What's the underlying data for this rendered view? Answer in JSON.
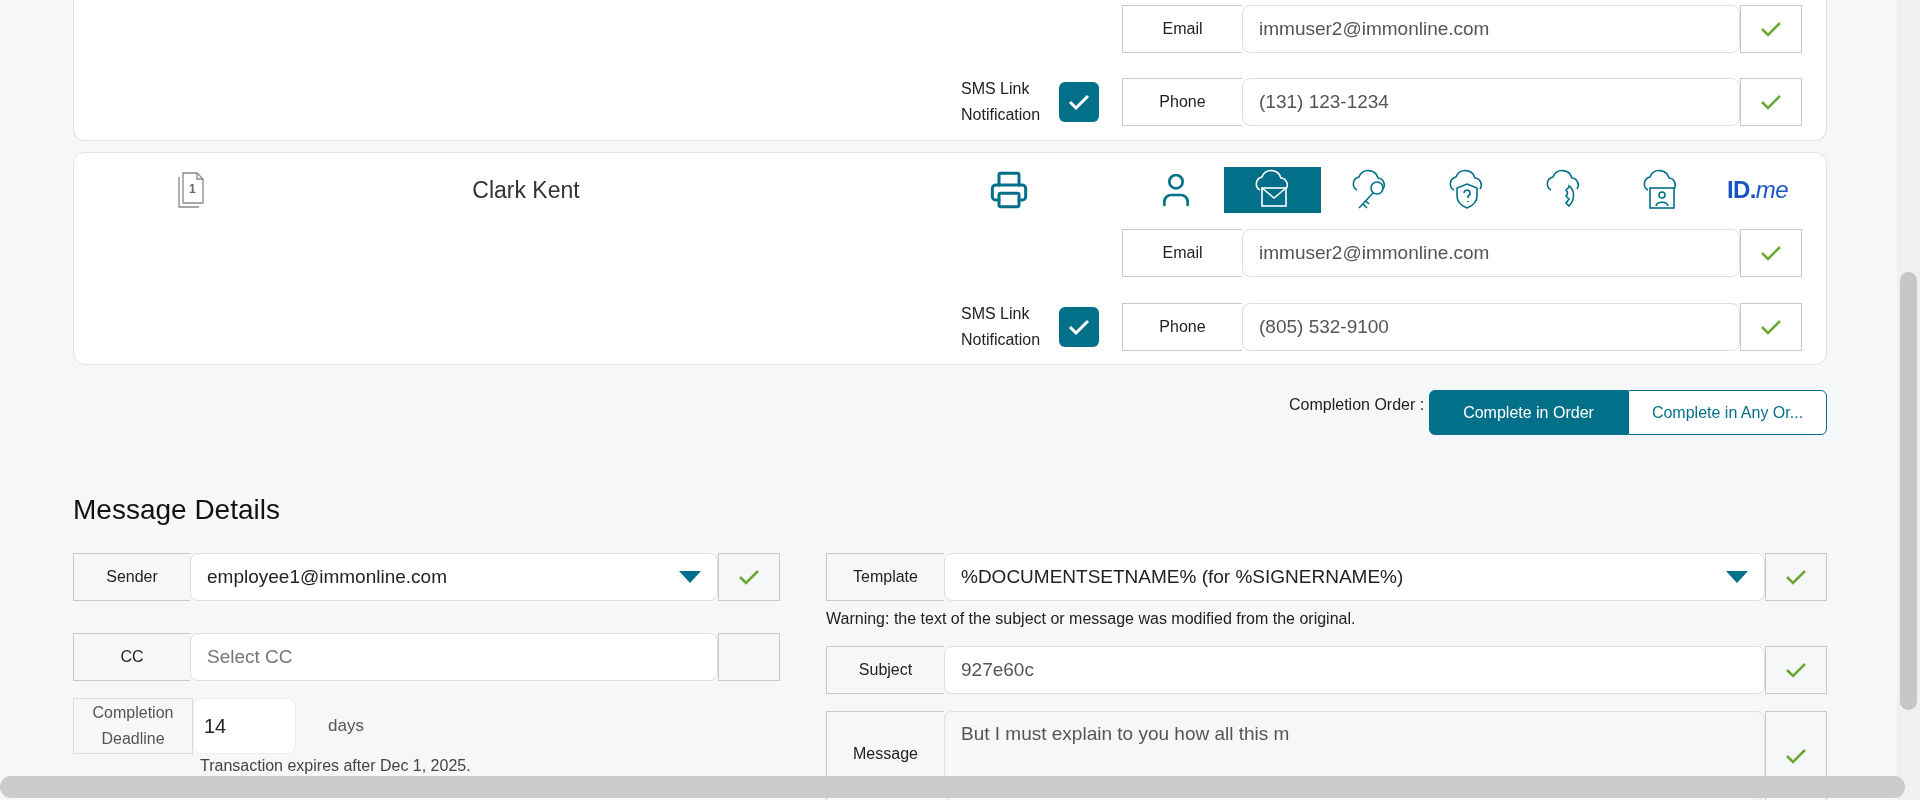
{
  "recipients": [
    {
      "email": {
        "label": "Email",
        "value": "immuser2@immonline.com",
        "valid": true
      },
      "sms": {
        "label": "SMS Link Notification",
        "checked": true
      },
      "phone": {
        "label": "Phone",
        "value": "(131) 123-1234",
        "valid": true
      }
    },
    {
      "page_count": "1",
      "name": "Clark Kent",
      "methods": [
        {
          "kind": "person",
          "selected": false
        },
        {
          "kind": "mail",
          "selected": true
        },
        {
          "kind": "key",
          "selected": false
        },
        {
          "kind": "question",
          "selected": false
        },
        {
          "kind": "phone",
          "selected": false
        },
        {
          "kind": "contact",
          "selected": false
        },
        {
          "kind": "idme",
          "text": "ID.",
          "suffix": "me",
          "selected": false
        }
      ],
      "email": {
        "label": "Email",
        "value": "immuser2@immonline.com",
        "valid": true
      },
      "sms": {
        "label": "SMS Link Notification",
        "checked": true
      },
      "phone": {
        "label": "Phone",
        "value": "(805) 532-9100",
        "valid": true
      }
    }
  ],
  "completion_order": {
    "label": "Completion Order :",
    "options": [
      {
        "label": "Complete in Order",
        "selected": true
      },
      {
        "label": "Complete in Any Or...",
        "selected": false
      }
    ]
  },
  "message_details": {
    "title": "Message Details",
    "sender": {
      "label": "Sender",
      "value": "employee1@immonline.com",
      "valid": true
    },
    "cc": {
      "label": "CC",
      "placeholder": "Select CC",
      "valid": false
    },
    "deadline": {
      "label": "Completion Deadline",
      "value": "14",
      "unit": "days",
      "note": "Transaction expires after Dec 1, 2025."
    },
    "template": {
      "label": "Template",
      "value": "%DOCUMENTSETNAME% (for %SIGNERNAME%)",
      "valid": true
    },
    "warning": "Warning: the text of the subject or message was modified from the original.",
    "subject": {
      "label": "Subject",
      "value": "927e60c",
      "valid": true
    },
    "message": {
      "label": "Message",
      "value": "But I must explain to you how all this m",
      "valid": true
    }
  }
}
